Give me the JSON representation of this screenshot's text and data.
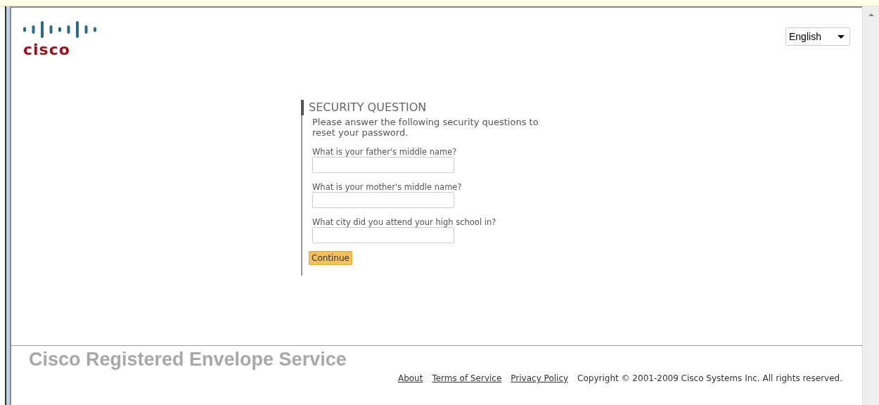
{
  "logo": {
    "wordmark": "cisco"
  },
  "language_select": {
    "value": "English"
  },
  "form": {
    "title": "SECURITY QUESTION",
    "intro": "Please answer the following security questions to reset your password.",
    "questions": [
      {
        "label": "What is your father's middle name?"
      },
      {
        "label": "What is your mother's middle name?"
      },
      {
        "label": "What city did you attend your high school in?"
      }
    ],
    "submit": "Continue"
  },
  "footer": {
    "service_name": "Cisco Registered Envelope Service",
    "links": [
      "About",
      "Terms of Service",
      "Privacy Policy"
    ],
    "copyright": "Copyright © 2001-2009 Cisco Systems Inc. All rights reserved."
  }
}
